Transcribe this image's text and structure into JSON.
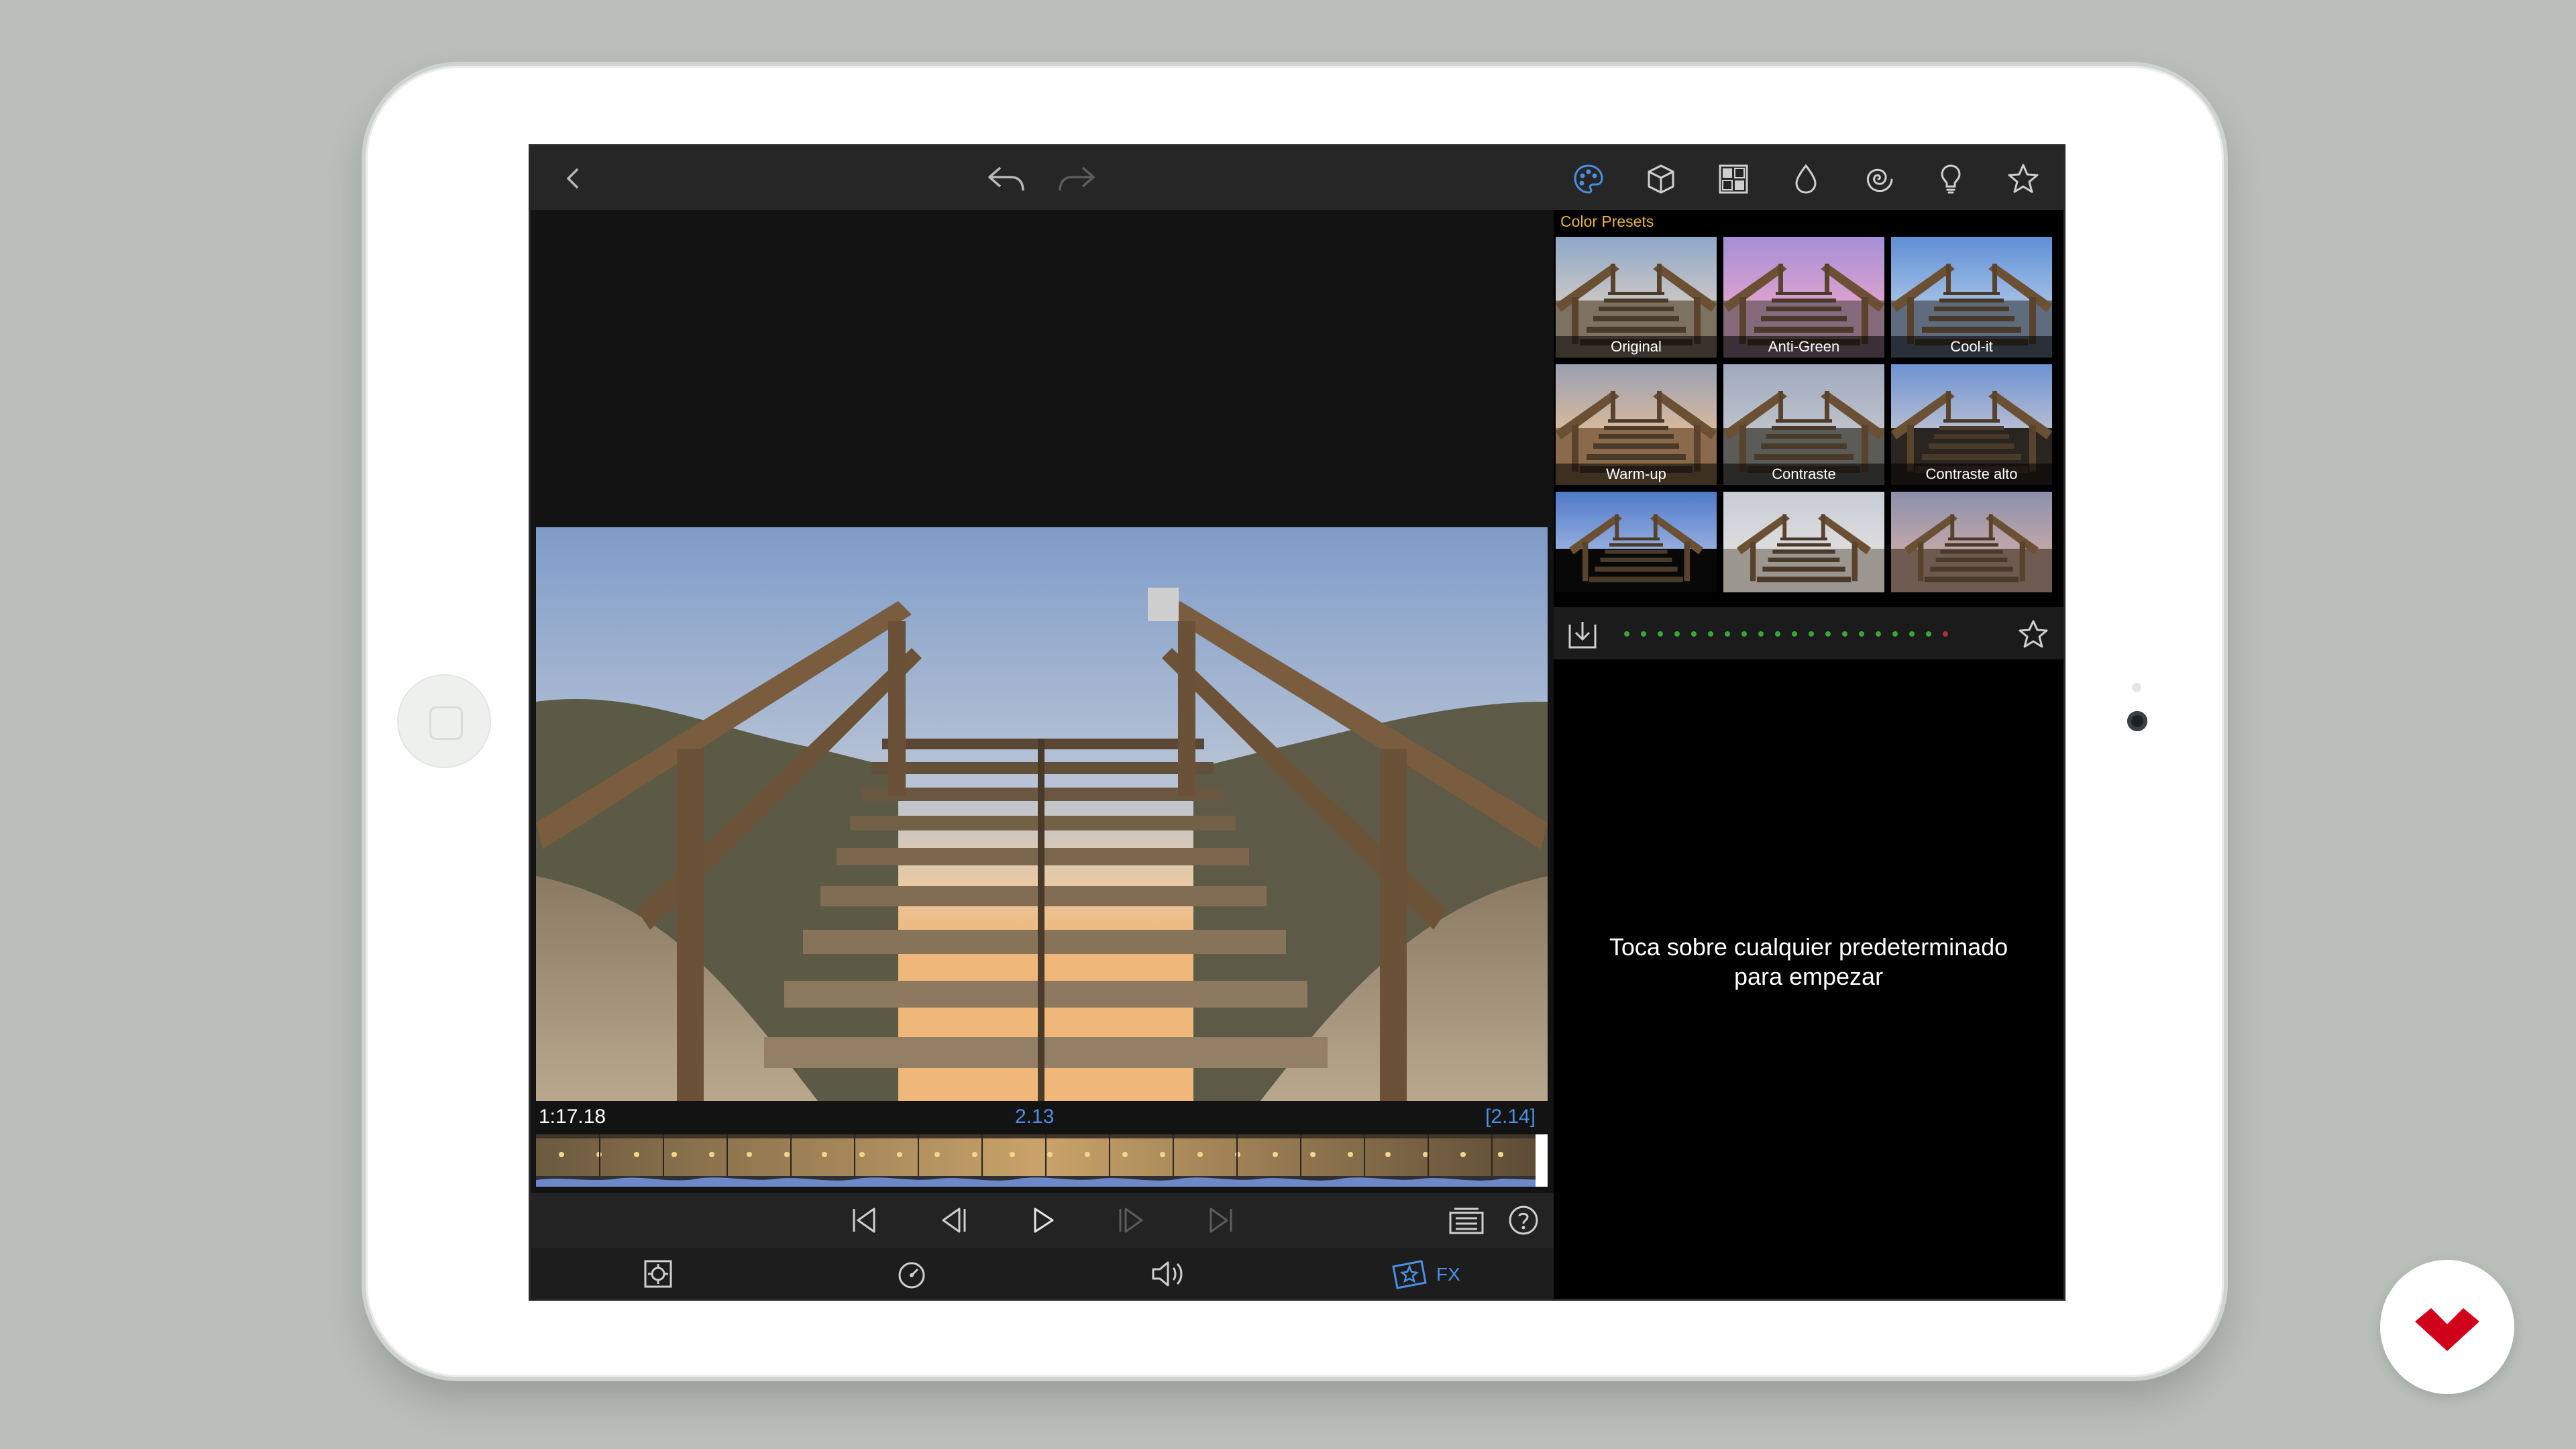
{
  "toolbar": {
    "back_icon": "chevron-left-icon",
    "undo_icon": "undo-icon",
    "redo_icon": "redo-icon",
    "tools": [
      "palette-icon",
      "cube-icon",
      "grid-icon",
      "drop-icon",
      "spiral-icon",
      "lightbulb-icon",
      "star-icon"
    ],
    "active_tool_color": "#4a90e2"
  },
  "timeline": {
    "current_time": "1:17.18",
    "clip_time": "2.13",
    "clip_duration": "[2.14]"
  },
  "bottom_tabs": {
    "fx_label": "FX",
    "active_color": "#4a90e2"
  },
  "panel": {
    "header": "Color Presets",
    "presets": [
      {
        "label": "Original"
      },
      {
        "label": "Anti-Green"
      },
      {
        "label": "Cool-it"
      },
      {
        "label": "Warm-up"
      },
      {
        "label": "Contraste"
      },
      {
        "label": "Contraste alto"
      },
      {
        "label": ""
      },
      {
        "label": ""
      },
      {
        "label": ""
      }
    ],
    "hint_line1": "Toca sobre cualquier predeterminado",
    "hint_line2": "para empezar",
    "header_color": "#e9b53c"
  }
}
